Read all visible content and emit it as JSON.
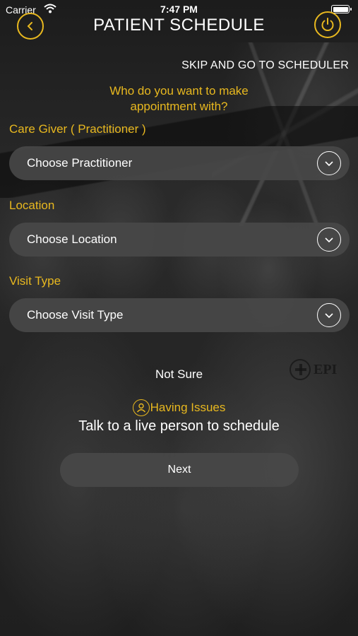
{
  "status_bar": {
    "carrier": "Carrier",
    "time": "7:47 PM"
  },
  "header": {
    "title": "PATIENT SCHEDULE"
  },
  "skip_link": "SKIP AND GO TO SCHEDULER",
  "question": {
    "line1": "Who do you want to make",
    "line2": "appointment with?"
  },
  "fields": [
    {
      "label": "Care Giver ( Practitioner )",
      "placeholder": "Choose Practitioner"
    },
    {
      "label": "Location",
      "placeholder": "Choose Location"
    },
    {
      "label": "Visit Type",
      "placeholder": "Choose Visit Type"
    }
  ],
  "not_sure": "Not Sure",
  "issues": {
    "label": "Having Issues",
    "subtext": "Talk to a live person to schedule"
  },
  "next_button": "Next",
  "background_logo": "EPI",
  "colors": {
    "accent": "#e8b81f",
    "field_bg": "#484848"
  },
  "icons": [
    "chevron-left-icon",
    "power-icon",
    "chevron-down-icon",
    "user-icon",
    "wifi-icon",
    "battery-icon"
  ]
}
